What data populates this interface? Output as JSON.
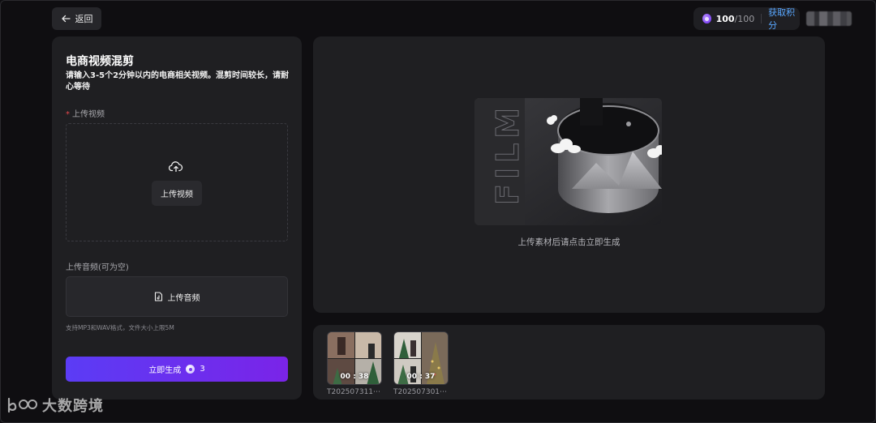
{
  "header": {
    "back_label": "返回",
    "points_current": "100",
    "points_max": "/100",
    "get_points_label": "获取积分"
  },
  "form": {
    "title": "电商视频混剪",
    "description": "请输入3-5个2分钟以内的电商相关视频。混剪时间较长，请耐心等待",
    "video_required_mark": "*",
    "video_label": "上传视频",
    "video_button_label": "上传视频",
    "audio_label": "上传音频(可为空)",
    "audio_button_label": "上传音频",
    "audio_hint": "支持MP3和WAV格式，文件大小上限5M",
    "generate_label": "立即生成",
    "generate_cost": "3"
  },
  "preview": {
    "art_text": "FILM",
    "hint": "上传素材后请点击立即生成"
  },
  "history": [
    {
      "duration": "00 : 38",
      "name": "T202507311⋯"
    },
    {
      "duration": "00 : 37",
      "name": "T202507301⋯"
    }
  ],
  "watermark": {
    "text": "大数跨境"
  },
  "colors": {
    "accent_start": "#5b3cf5",
    "accent_end": "#7a24e8",
    "link": "#59a7ff",
    "required": "#e5484d"
  }
}
